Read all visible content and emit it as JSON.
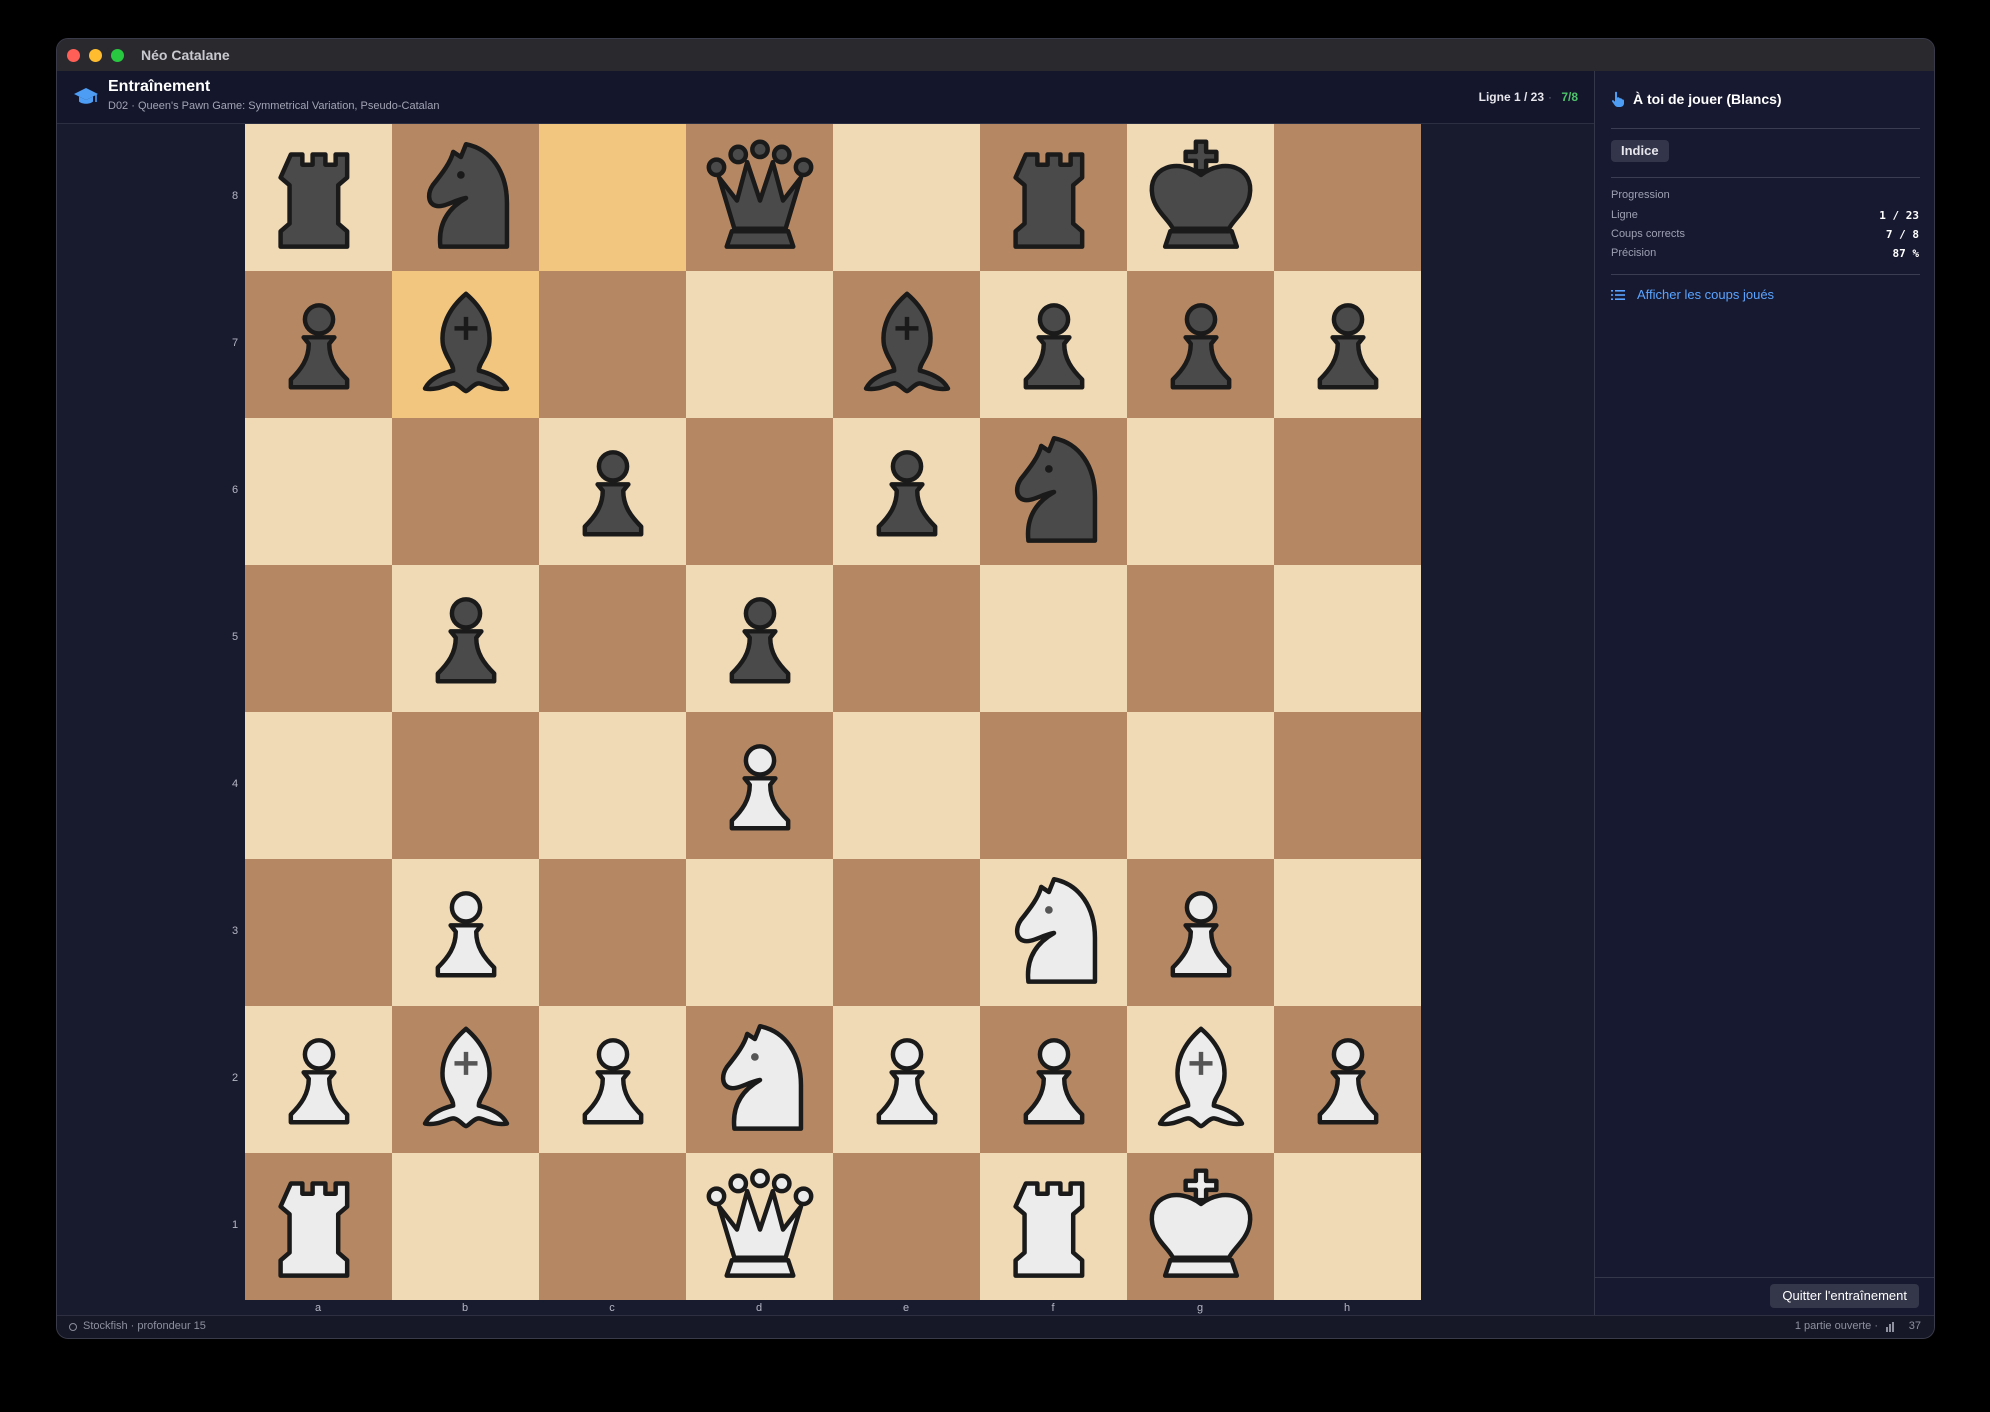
{
  "window": {
    "title": "Néo Catalane"
  },
  "header": {
    "title": "Entraînement",
    "subtitle": "D02 · Queen's Pawn Game: Symmetrical Variation, Pseudo-Catalan",
    "line_label": "Ligne 1 / 23",
    "separator": "·",
    "score": "7/8",
    "icon": "graduation-cap-icon"
  },
  "board": {
    "files": [
      "a",
      "b",
      "c",
      "d",
      "e",
      "f",
      "g",
      "h"
    ],
    "ranks": [
      "8",
      "7",
      "6",
      "5",
      "4",
      "3",
      "2",
      "1"
    ],
    "highlighted_squares": [
      "c8",
      "b7"
    ],
    "position": [
      [
        "bR",
        "bN",
        "",
        "bQ",
        "",
        "bR",
        "bK",
        ""
      ],
      [
        "bP",
        "bB",
        "",
        "",
        "bB",
        "bP",
        "bP",
        "bP"
      ],
      [
        "",
        "",
        "bP",
        "",
        "bP",
        "bN",
        "",
        ""
      ],
      [
        "",
        "bP",
        "",
        "bP",
        "",
        "",
        "",
        ""
      ],
      [
        "",
        "",
        "",
        "wP",
        "",
        "",
        "",
        ""
      ],
      [
        "",
        "wP",
        "",
        "",
        "",
        "wN",
        "wP",
        ""
      ],
      [
        "wP",
        "wB",
        "wP",
        "wN",
        "wP",
        "wP",
        "wB",
        "wP"
      ],
      [
        "wR",
        "",
        "",
        "wQ",
        "",
        "wR",
        "wK",
        ""
      ]
    ],
    "colors": {
      "light": "#f0d9b5",
      "dark": "#b58863",
      "highlight": "#f2c67f"
    }
  },
  "sidebar": {
    "turn_text": "À toi de jouer (Blancs)",
    "turn_icon": "hand-pointer-icon",
    "hint_label": "Indice",
    "progress_title": "Progression",
    "stats": [
      {
        "label": "Ligne",
        "value": "1 / 23"
      },
      {
        "label": "Coups corrects",
        "value": "7 / 8"
      },
      {
        "label": "Précision",
        "value": "87 %"
      }
    ],
    "moves_link": "Afficher les coups joués",
    "moves_icon": "list-icon",
    "quit_label": "Quitter l'entraînement"
  },
  "statusbar": {
    "engine": "Stockfish · profondeur 15",
    "games": "1 partie ouverte ·",
    "count": "37"
  },
  "accents": {
    "link": "#5aa4ff",
    "score": "#4cc46a"
  }
}
